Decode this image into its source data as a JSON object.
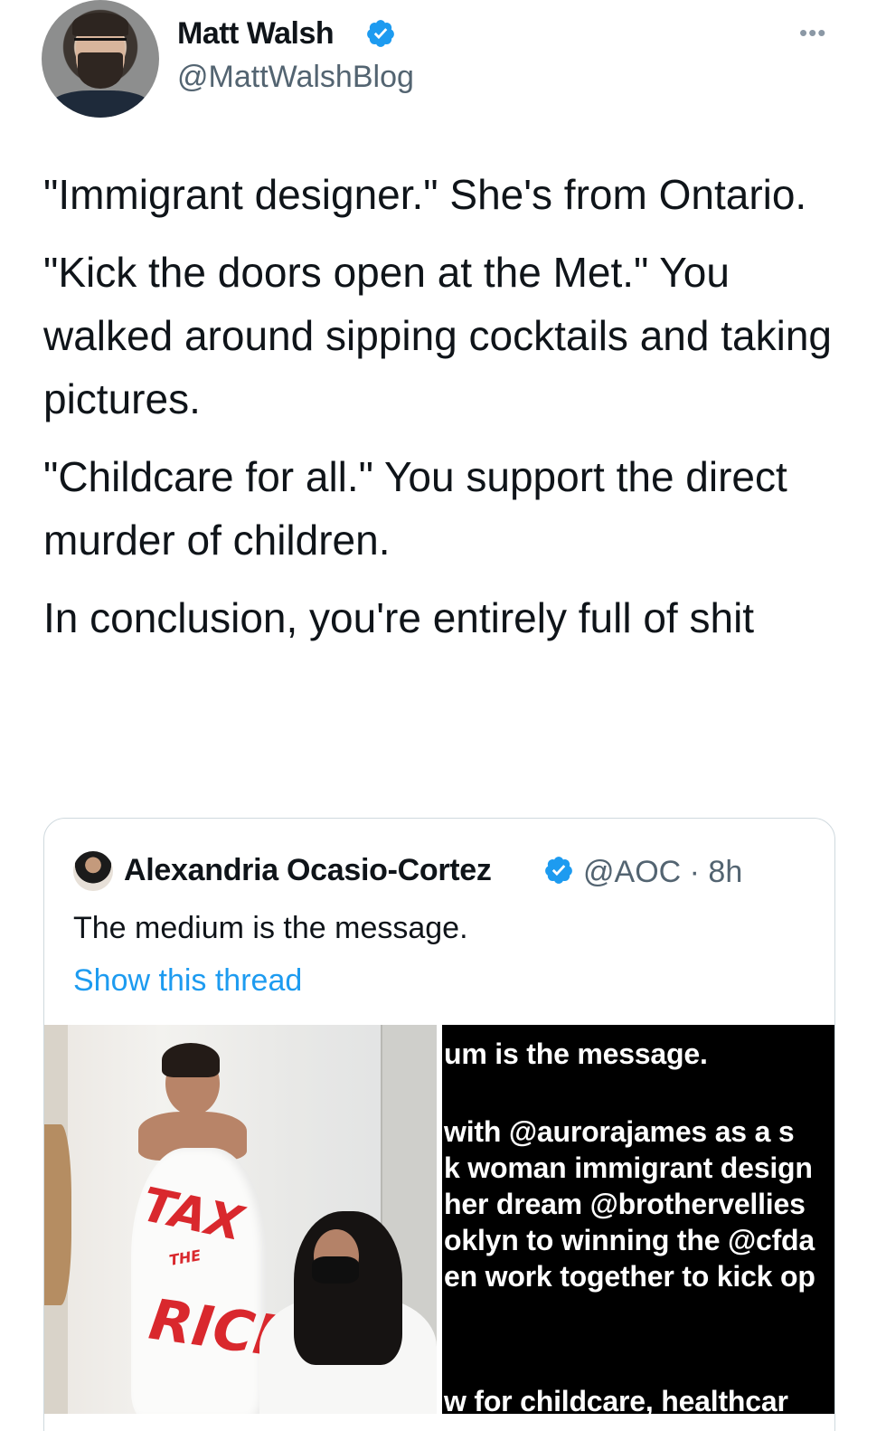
{
  "tweet": {
    "author_name": "Matt Walsh",
    "author_handle": "@MattWalshBlog",
    "paragraphs": [
      "\"Immigrant designer.\" She's from Ontario.",
      "\"Kick the doors open at the Met.\" You walked around sipping cocktails and taking pictures.",
      "\"Childcare for all.\" You support the direct murder of children.",
      "In conclusion, you're entirely full of shit"
    ]
  },
  "quoted_tweet": {
    "author_name": "Alexandria Ocasio-Cortez",
    "author_handle": "@AOC · 8h",
    "text": "The medium is the message.",
    "show_thread": "Show this thread",
    "photo_text": [
      "TAX",
      "THE",
      "RICH"
    ],
    "screenshot_lines": [
      "um is the message.",
      "with @aurorajames as a s",
      "k woman immigrant design",
      "her dream @brothervellies",
      "oklyn to winning the @cfda",
      "en work together to kick op",
      "w for childcare, healthcar"
    ]
  },
  "colors": {
    "link": "#1d9bf0",
    "verified": "#1d9bf0",
    "secondary_text": "#536471",
    "border": "#cfd9de"
  },
  "icons": [
    "verified-badge-icon",
    "more-options-icon"
  ]
}
